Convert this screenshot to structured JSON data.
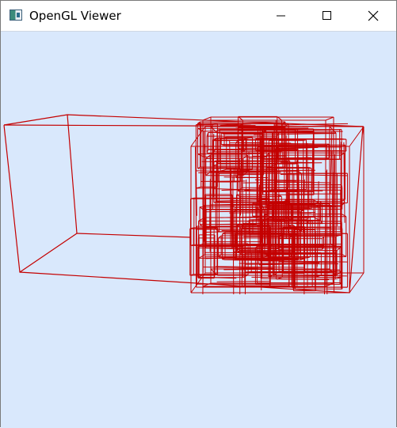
{
  "window": {
    "title": "OpenGL Viewer",
    "icon": "app-window-icon"
  },
  "controls": {
    "minimize_icon": "minimize-icon",
    "maximize_icon": "maximize-icon",
    "close_icon": "close-icon"
  },
  "viewport": {
    "background": "#d9e8fc",
    "wire_color": "#c40000"
  }
}
